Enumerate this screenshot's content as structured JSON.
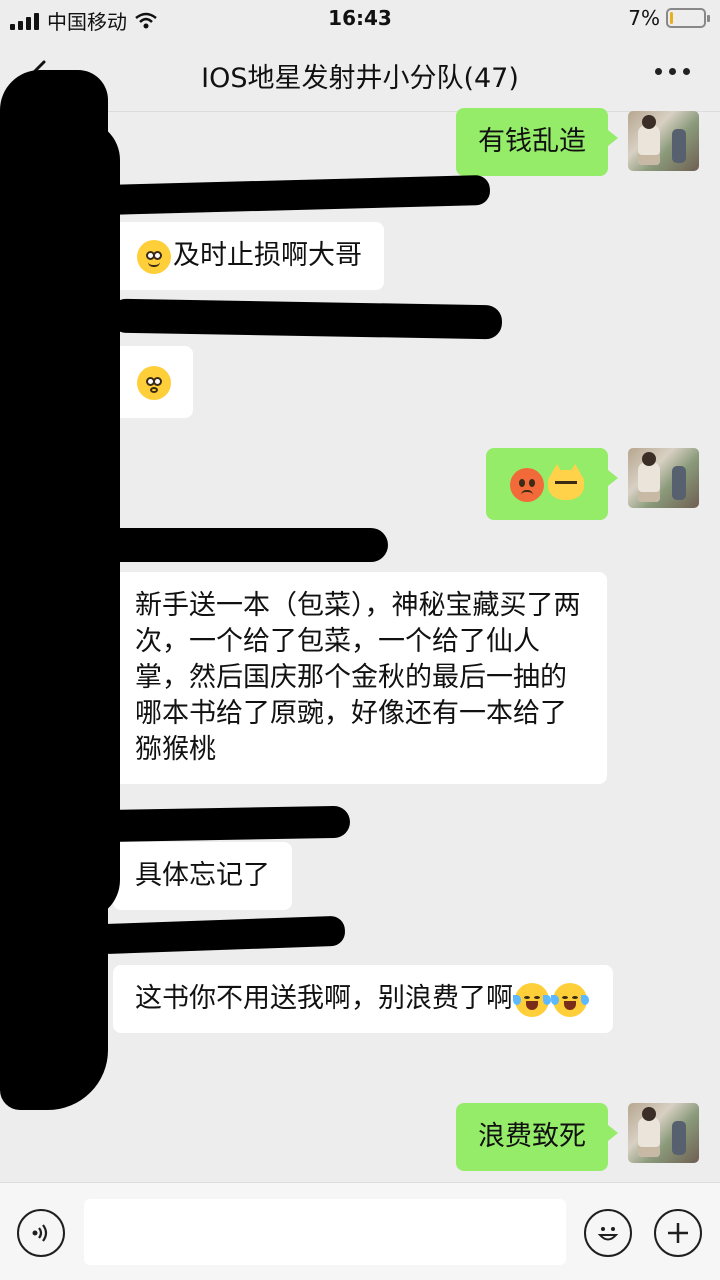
{
  "status": {
    "carrier": "中国移动",
    "time": "16:43",
    "battery": "7%",
    "battery_level": 0.07
  },
  "header": {
    "title": "IOS地星发射井小分队(47)"
  },
  "messages": [
    {
      "dir": "out",
      "text": "有钱乱造"
    },
    {
      "dir": "in",
      "text": "及时止损啊大哥",
      "emoji": "pleading-face-icon"
    },
    {
      "dir": "in",
      "text": "",
      "emoji": "flushed-face-icon"
    },
    {
      "dir": "out",
      "text": "",
      "emoji": [
        "angry-face-icon",
        "cat-face-icon"
      ]
    },
    {
      "dir": "in",
      "text": "新手送一本（包菜），神秘宝藏买了两次，一个给了包菜，一个给了仙人掌，然后国庆那个金秋的最后一抽的哪本书给了原豌，好像还有一本给了猕猴桃"
    },
    {
      "dir": "in",
      "text": "具体忘记了"
    },
    {
      "dir": "in",
      "text": "这书你不用送我啊，别浪费了啊",
      "emoji": "tears-of-joy-icon"
    },
    {
      "dir": "out",
      "text": "浪费致死"
    }
  ],
  "input": {
    "value": ""
  },
  "colors": {
    "background": "#ededed",
    "bubble_out": "#95ec69",
    "bubble_in": "#ffffff",
    "battery_low": "#e7b11c"
  }
}
